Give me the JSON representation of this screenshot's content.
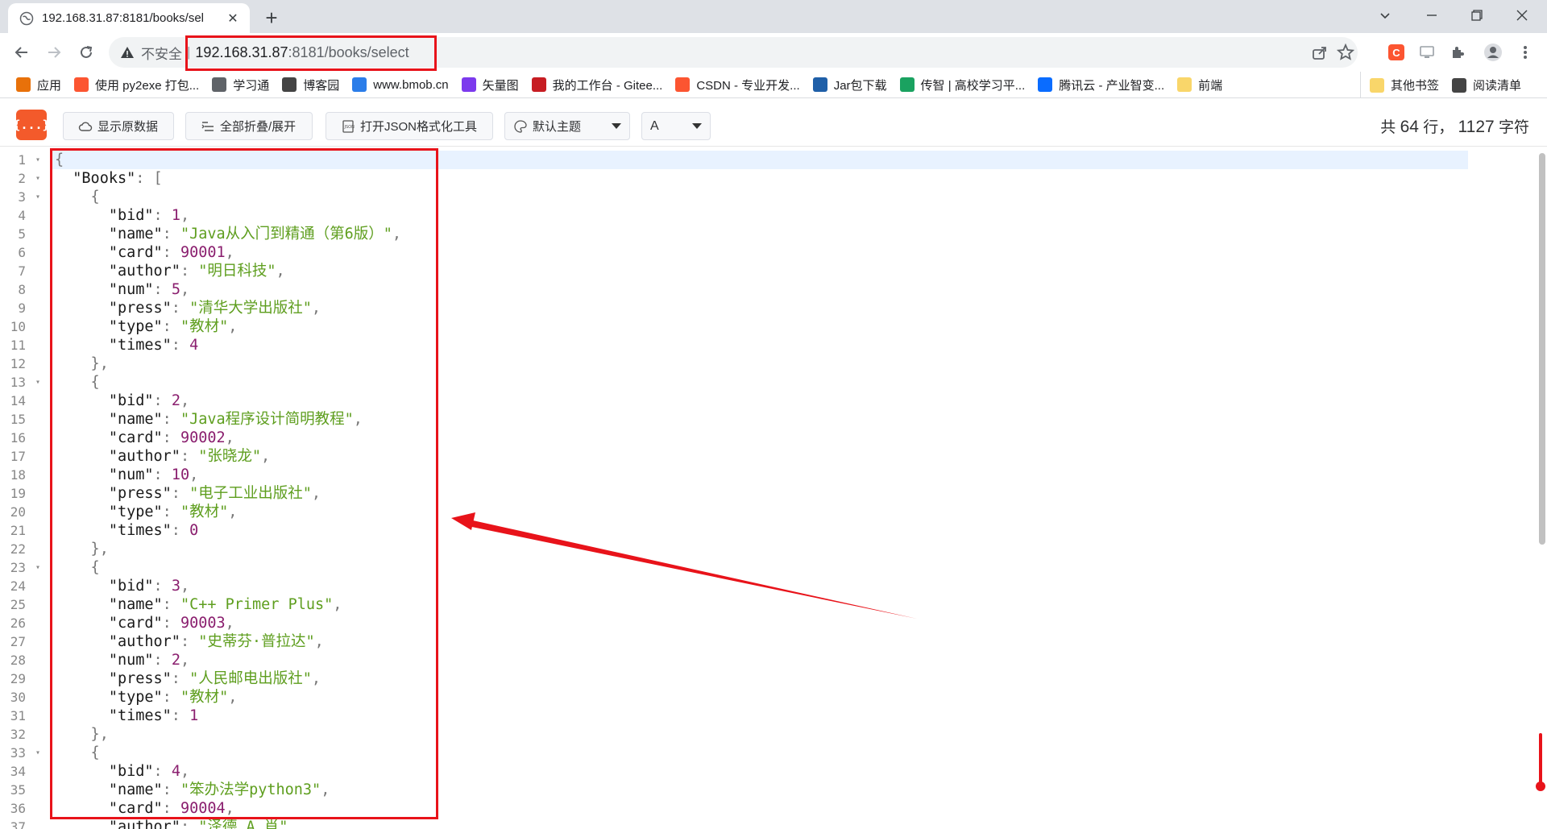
{
  "tab": {
    "title": "192.168.31.87:8181/books/sel",
    "close_glyph": "✕",
    "newtab_glyph": "+"
  },
  "window_controls": {
    "minimize": "—",
    "restore": "❐",
    "close": "✕",
    "dropdown": "⌄"
  },
  "omnibox": {
    "security_text": "不安全",
    "separator": "|",
    "url_host": "192.168.31.87",
    "url_rest": ":8181/books/select"
  },
  "bookmarks": [
    {
      "label": "应用",
      "icon": "apps-grid-icon",
      "color": "#e8710a"
    },
    {
      "label": "使用 py2exe 打包...",
      "icon": "csdn-icon",
      "color": "#fc5531"
    },
    {
      "label": "学习通",
      "icon": "globe-icon",
      "color": "#5f6368"
    },
    {
      "label": "博客园",
      "icon": "cnblogs-icon",
      "color": "#444444"
    },
    {
      "label": "www.bmob.cn",
      "icon": "bmob-icon",
      "color": "#2b7de9"
    },
    {
      "label": "矢量图",
      "icon": "iconfont-icon",
      "color": "#7c3aed"
    },
    {
      "label": "我的工作台 - Gitee...",
      "icon": "gitee-icon",
      "color": "#c71d23"
    },
    {
      "label": "CSDN - 专业开发...",
      "icon": "csdn-icon",
      "color": "#fc5531"
    },
    {
      "label": "Jar包下载",
      "icon": "mvn-icon",
      "color": "#1f5fa8"
    },
    {
      "label": "传智 | 高校学习平...",
      "icon": "chuanzhi-icon",
      "color": "#1aa260"
    },
    {
      "label": "腾讯云 - 产业智变...",
      "icon": "tencent-cloud-icon",
      "color": "#0a6cff"
    },
    {
      "label": "前端",
      "icon": "folder-icon",
      "color": "#f9d66a"
    }
  ],
  "bookmarks_right": [
    {
      "label": "其他书签",
      "icon": "folder-icon",
      "color": "#f9d66a"
    },
    {
      "label": "阅读清单",
      "icon": "reading-list-icon",
      "color": "#444444"
    }
  ],
  "json_toolbar": {
    "logo_text": "{...}",
    "btn_raw": "显示原数据",
    "btn_fold": "全部折叠/展开",
    "btn_tool": "打开JSON格式化工具",
    "theme_select": "默认主题",
    "font_select": "A",
    "stats_prefix": "共",
    "stats_lines": "64",
    "stats_mid": "行，",
    "stats_chars": "1127",
    "stats_suffix": "字符"
  },
  "gutter": [
    {
      "num": "1",
      "fold": true
    },
    {
      "num": "2",
      "fold": true
    },
    {
      "num": "3",
      "fold": true
    },
    {
      "num": "4",
      "fold": false
    },
    {
      "num": "5",
      "fold": false
    },
    {
      "num": "6",
      "fold": false
    },
    {
      "num": "7",
      "fold": false
    },
    {
      "num": "8",
      "fold": false
    },
    {
      "num": "9",
      "fold": false
    },
    {
      "num": "10",
      "fold": false
    },
    {
      "num": "11",
      "fold": false
    },
    {
      "num": "12",
      "fold": false
    },
    {
      "num": "13",
      "fold": true
    },
    {
      "num": "14",
      "fold": false
    },
    {
      "num": "15",
      "fold": false
    },
    {
      "num": "16",
      "fold": false
    },
    {
      "num": "17",
      "fold": false
    },
    {
      "num": "18",
      "fold": false
    },
    {
      "num": "19",
      "fold": false
    },
    {
      "num": "20",
      "fold": false
    },
    {
      "num": "21",
      "fold": false
    },
    {
      "num": "22",
      "fold": false
    },
    {
      "num": "23",
      "fold": true
    },
    {
      "num": "24",
      "fold": false
    },
    {
      "num": "25",
      "fold": false
    },
    {
      "num": "26",
      "fold": false
    },
    {
      "num": "27",
      "fold": false
    },
    {
      "num": "28",
      "fold": false
    },
    {
      "num": "29",
      "fold": false
    },
    {
      "num": "30",
      "fold": false
    },
    {
      "num": "31",
      "fold": false
    },
    {
      "num": "32",
      "fold": false
    },
    {
      "num": "33",
      "fold": true
    },
    {
      "num": "34",
      "fold": false
    },
    {
      "num": "35",
      "fold": false
    },
    {
      "num": "36",
      "fold": false
    },
    {
      "num": "37",
      "fold": false
    }
  ],
  "code_lines": [
    [
      [
        "p",
        "{"
      ]
    ],
    [
      [
        "k",
        "  \"Books\""
      ],
      [
        "p",
        ": ["
      ]
    ],
    [
      [
        "p",
        "    {"
      ]
    ],
    [
      [
        "k",
        "      \"bid\""
      ],
      [
        "p",
        ": "
      ],
      [
        "n",
        "1"
      ],
      [
        "p",
        ","
      ]
    ],
    [
      [
        "k",
        "      \"name\""
      ],
      [
        "p",
        ": "
      ],
      [
        "s",
        "\"Java从入门到精通（第6版）\""
      ],
      [
        "p",
        ","
      ]
    ],
    [
      [
        "k",
        "      \"card\""
      ],
      [
        "p",
        ": "
      ],
      [
        "n",
        "90001"
      ],
      [
        "p",
        ","
      ]
    ],
    [
      [
        "k",
        "      \"author\""
      ],
      [
        "p",
        ": "
      ],
      [
        "s",
        "\"明日科技\""
      ],
      [
        "p",
        ","
      ]
    ],
    [
      [
        "k",
        "      \"num\""
      ],
      [
        "p",
        ": "
      ],
      [
        "n",
        "5"
      ],
      [
        "p",
        ","
      ]
    ],
    [
      [
        "k",
        "      \"press\""
      ],
      [
        "p",
        ": "
      ],
      [
        "s",
        "\"清华大学出版社\""
      ],
      [
        "p",
        ","
      ]
    ],
    [
      [
        "k",
        "      \"type\""
      ],
      [
        "p",
        ": "
      ],
      [
        "s",
        "\"教材\""
      ],
      [
        "p",
        ","
      ]
    ],
    [
      [
        "k",
        "      \"times\""
      ],
      [
        "p",
        ": "
      ],
      [
        "n",
        "4"
      ]
    ],
    [
      [
        "p",
        "    },"
      ]
    ],
    [
      [
        "p",
        "    {"
      ]
    ],
    [
      [
        "k",
        "      \"bid\""
      ],
      [
        "p",
        ": "
      ],
      [
        "n",
        "2"
      ],
      [
        "p",
        ","
      ]
    ],
    [
      [
        "k",
        "      \"name\""
      ],
      [
        "p",
        ": "
      ],
      [
        "s",
        "\"Java程序设计简明教程\""
      ],
      [
        "p",
        ","
      ]
    ],
    [
      [
        "k",
        "      \"card\""
      ],
      [
        "p",
        ": "
      ],
      [
        "n",
        "90002"
      ],
      [
        "p",
        ","
      ]
    ],
    [
      [
        "k",
        "      \"author\""
      ],
      [
        "p",
        ": "
      ],
      [
        "s",
        "\"张晓龙\""
      ],
      [
        "p",
        ","
      ]
    ],
    [
      [
        "k",
        "      \"num\""
      ],
      [
        "p",
        ": "
      ],
      [
        "n",
        "10"
      ],
      [
        "p",
        ","
      ]
    ],
    [
      [
        "k",
        "      \"press\""
      ],
      [
        "p",
        ": "
      ],
      [
        "s",
        "\"电子工业出版社\""
      ],
      [
        "p",
        ","
      ]
    ],
    [
      [
        "k",
        "      \"type\""
      ],
      [
        "p",
        ": "
      ],
      [
        "s",
        "\"教材\""
      ],
      [
        "p",
        ","
      ]
    ],
    [
      [
        "k",
        "      \"times\""
      ],
      [
        "p",
        ": "
      ],
      [
        "n",
        "0"
      ]
    ],
    [
      [
        "p",
        "    },"
      ]
    ],
    [
      [
        "p",
        "    {"
      ]
    ],
    [
      [
        "k",
        "      \"bid\""
      ],
      [
        "p",
        ": "
      ],
      [
        "n",
        "3"
      ],
      [
        "p",
        ","
      ]
    ],
    [
      [
        "k",
        "      \"name\""
      ],
      [
        "p",
        ": "
      ],
      [
        "s",
        "\"C++ Primer Plus\""
      ],
      [
        "p",
        ","
      ]
    ],
    [
      [
        "k",
        "      \"card\""
      ],
      [
        "p",
        ": "
      ],
      [
        "n",
        "90003"
      ],
      [
        "p",
        ","
      ]
    ],
    [
      [
        "k",
        "      \"author\""
      ],
      [
        "p",
        ": "
      ],
      [
        "s",
        "\"史蒂芬·普拉达\""
      ],
      [
        "p",
        ","
      ]
    ],
    [
      [
        "k",
        "      \"num\""
      ],
      [
        "p",
        ": "
      ],
      [
        "n",
        "2"
      ],
      [
        "p",
        ","
      ]
    ],
    [
      [
        "k",
        "      \"press\""
      ],
      [
        "p",
        ": "
      ],
      [
        "s",
        "\"人民邮电出版社\""
      ],
      [
        "p",
        ","
      ]
    ],
    [
      [
        "k",
        "      \"type\""
      ],
      [
        "p",
        ": "
      ],
      [
        "s",
        "\"教材\""
      ],
      [
        "p",
        ","
      ]
    ],
    [
      [
        "k",
        "      \"times\""
      ],
      [
        "p",
        ": "
      ],
      [
        "n",
        "1"
      ]
    ],
    [
      [
        "p",
        "    },"
      ]
    ],
    [
      [
        "p",
        "    {"
      ]
    ],
    [
      [
        "k",
        "      \"bid\""
      ],
      [
        "p",
        ": "
      ],
      [
        "n",
        "4"
      ],
      [
        "p",
        ","
      ]
    ],
    [
      [
        "k",
        "      \"name\""
      ],
      [
        "p",
        ": "
      ],
      [
        "s",
        "\"笨办法学python3\""
      ],
      [
        "p",
        ","
      ]
    ],
    [
      [
        "k",
        "      \"card\""
      ],
      [
        "p",
        ": "
      ],
      [
        "n",
        "90004"
      ],
      [
        "p",
        ","
      ]
    ],
    [
      [
        "k",
        "      \"author\""
      ],
      [
        "p",
        ": "
      ],
      [
        "s",
        "\"泽德 A.肖\""
      ],
      [
        "p",
        ","
      ]
    ]
  ],
  "colors": {
    "annotation_red": "#e8131a",
    "json_key": "#1a1a1a",
    "json_string": "#5e9e1e",
    "json_number": "#8a1e6e",
    "logo_bg": "#f35a2b"
  }
}
